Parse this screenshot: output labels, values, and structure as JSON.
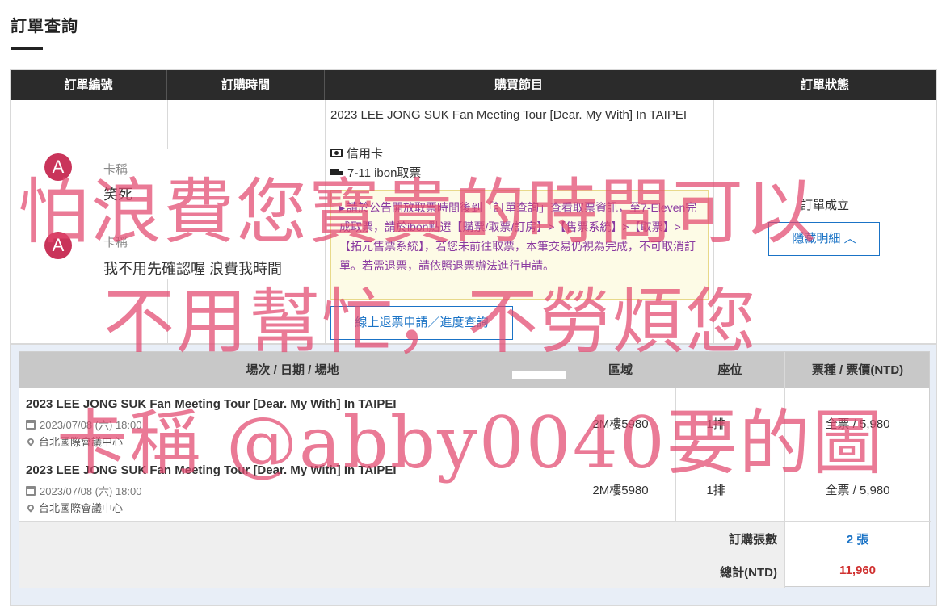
{
  "page": {
    "title": "訂單查詢"
  },
  "order_table": {
    "headers": [
      "訂單編號",
      "訂購時間",
      "購買節目",
      "訂單狀態"
    ],
    "program_title": "2023 LEE JONG SUK Fan Meeting Tour [Dear. My With] In TAIPEI",
    "payment": "信用卡",
    "shipping": "7-11 ibon取票",
    "notice": "請於公告開放取票時間後到「訂單查詢」查看取票資訊，至7-Eleven完成取票，請於ibon點選【購票/取票/訂房】>【售票系統】>【取票】>【拓元售票系統】，若您未前往取票，本筆交易仍視為完成，不可取消訂單。若需退票，請依照退票辦法進行申請。",
    "refund_button": "線上退票申請／進度查詢",
    "status": "訂單成立",
    "hide_button": "隱藏明細 ︿"
  },
  "chat": {
    "messages": [
      {
        "avatar": "A",
        "name": "卡稱",
        "text": "笑死"
      },
      {
        "avatar": "A",
        "name": "卡稱",
        "text": "我不用先確認喔 浪費我時間"
      }
    ]
  },
  "detail": {
    "headers": [
      "場次 / 日期 / 場地",
      "區域",
      "座位",
      "票種 / 票價(NTD)"
    ],
    "rows": [
      {
        "event": "2023 LEE JONG SUK Fan Meeting Tour [Dear. My With] In TAIPEI",
        "date": "2023/07/08 (六) 18:00",
        "venue": "台北國際會議中心",
        "area": "2M樓5980",
        "seat": "1排",
        "ticket": "全票 / 5,980"
      },
      {
        "event": "2023 LEE JONG SUK Fan Meeting Tour [Dear. My With] In TAIPEI",
        "date": "2023/07/08 (六) 18:00",
        "venue": "台北國際會議中心",
        "area": "2M樓5980",
        "seat": "1排",
        "ticket": "全票 / 5,980"
      }
    ],
    "count_label": "訂購張數",
    "count_value": "2 張",
    "total_label": "總計(NTD)",
    "total_value": "11,960"
  },
  "watermark": {
    "line1": "怕浪費您寶貴的時間可以",
    "line2": "不用幫忙，不勞煩您",
    "line3": "卡稱 @abby0040要的圖"
  },
  "colors": {
    "header_bg": "#2b2b2b",
    "accent_blue": "#1a73c6",
    "notice_text": "#8a3aa0",
    "total_red": "#d0302f",
    "watermark": "#e2466e"
  }
}
